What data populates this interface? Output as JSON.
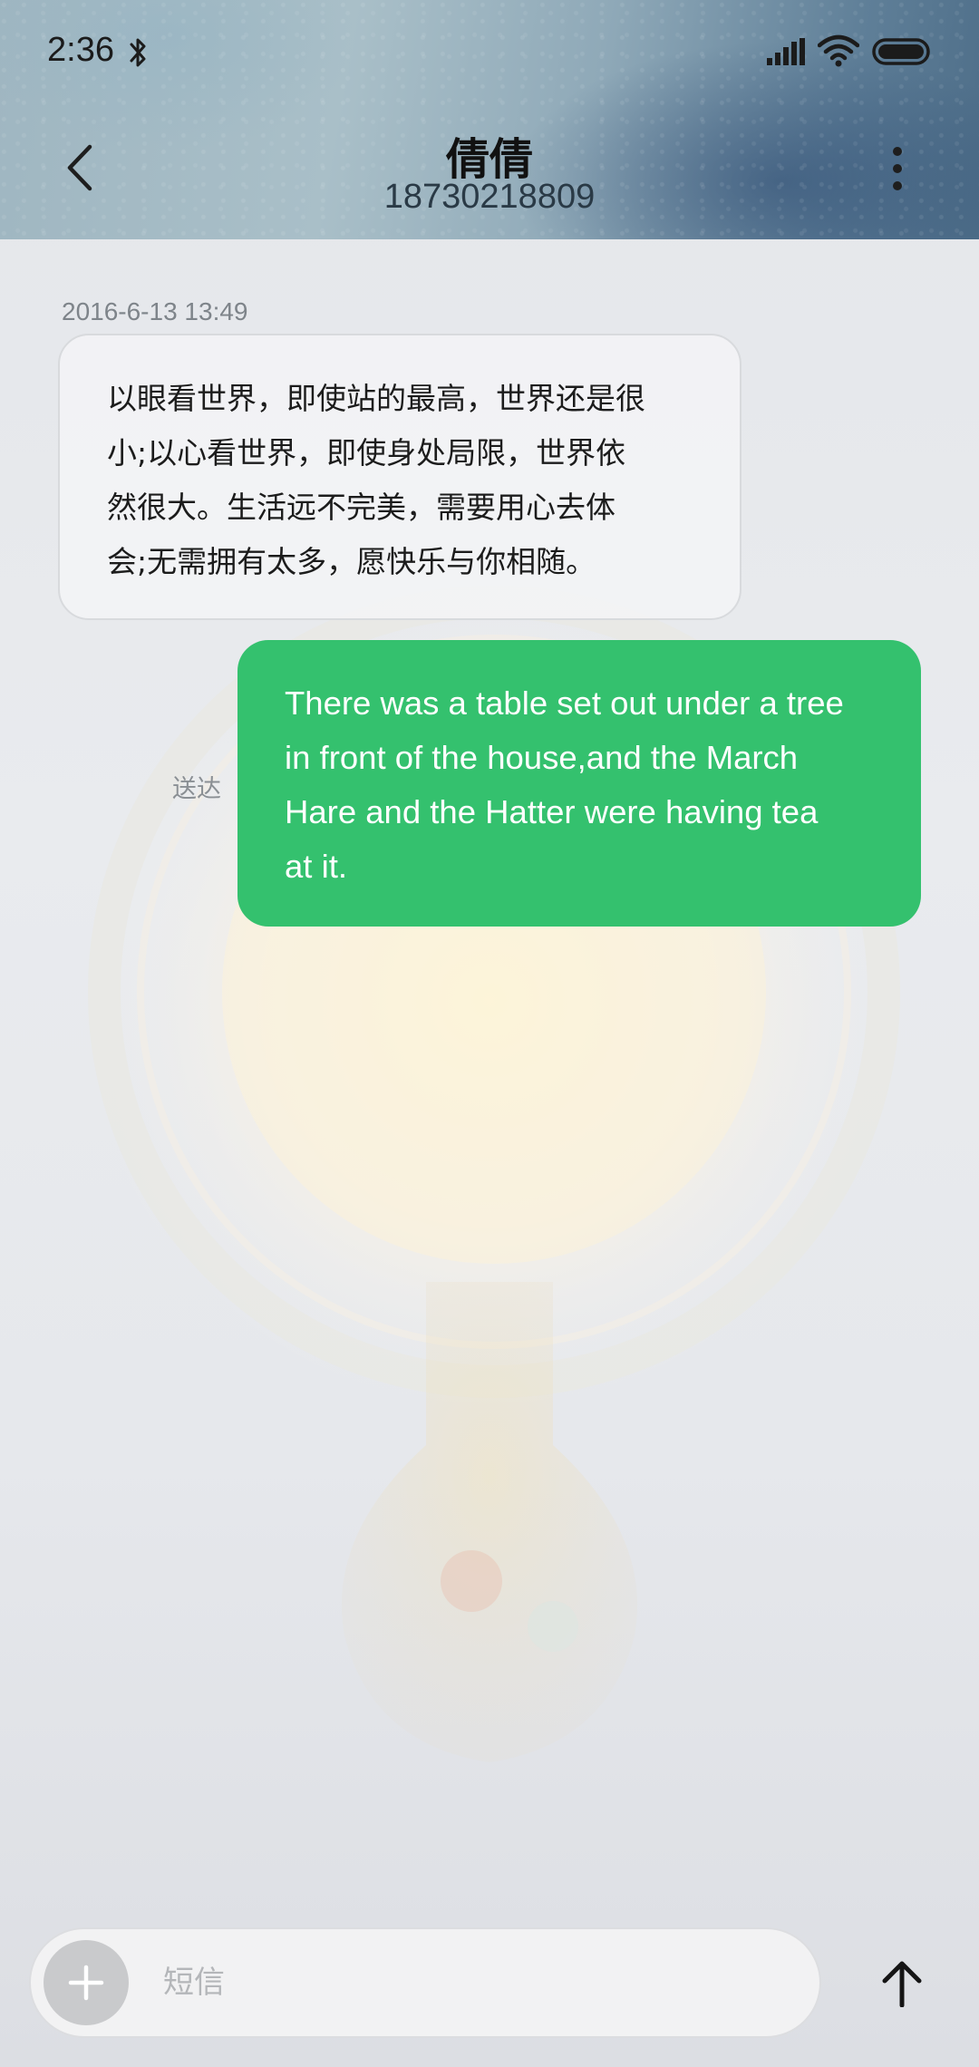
{
  "status_bar": {
    "time": "2:36",
    "icons": [
      "bluetooth-icon",
      "signal-icon",
      "wifi-icon",
      "battery-icon"
    ]
  },
  "header": {
    "contact_name": "倩倩",
    "contact_number": "18730218809",
    "back_icon": "chevron-left-icon",
    "more_icon": "more-vertical-icon"
  },
  "conversation": {
    "timestamp": "2016-6-13 13:49",
    "incoming_message": "以眼看世界，即使站的最高，世界还是很\n小;以心看世界，即使身处局限，世界依\n然很大。生活远不完美，需要用心去体\n会;无需拥有太多，愿快乐与你相随。",
    "outgoing_message": "There was a table set out under a tree\nin front of the house,and the March\nHare and the Hatter were having tea\nat it.",
    "delivery_status": "送达"
  },
  "composer": {
    "placeholder": "短信",
    "value": "",
    "attach_icon": "plus-icon",
    "send_icon": "arrow-up-icon"
  },
  "colors": {
    "outgoing_bubble": "#34c16e",
    "incoming_bubble": "#f3f3f5",
    "background": "#e6e8ec"
  }
}
